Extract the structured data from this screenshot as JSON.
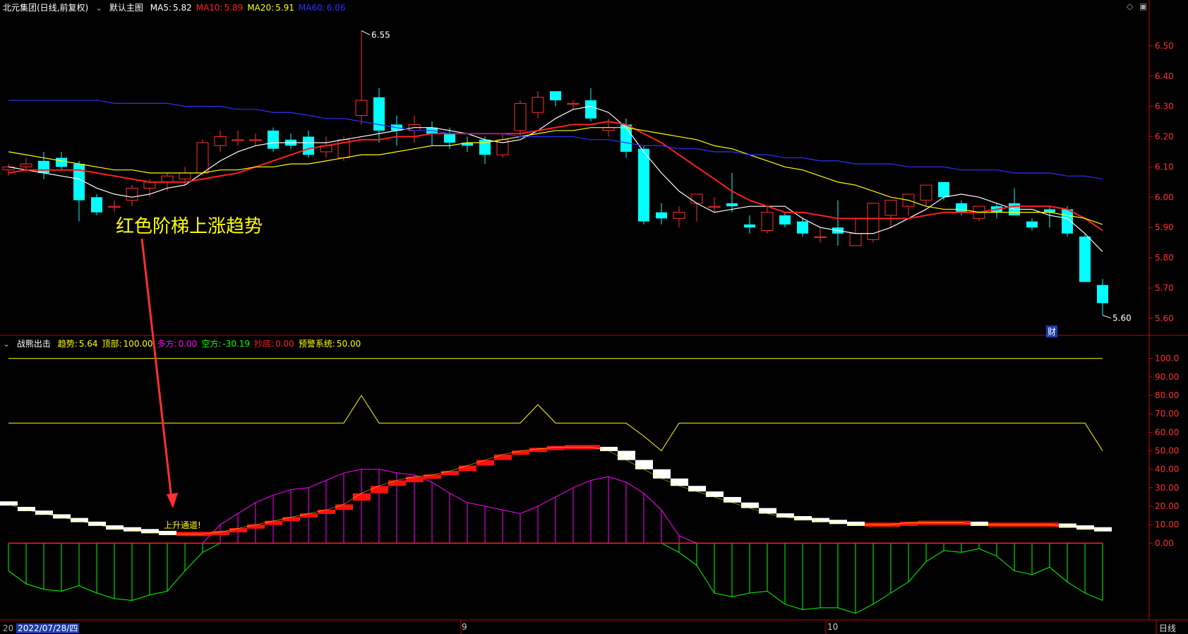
{
  "main_panel": {
    "header": {
      "symbol": "北元集团(日线,前复权)",
      "template": "默认主图",
      "ma": [
        {
          "label": "MA5:",
          "value": "5.82",
          "color": "#ffffff"
        },
        {
          "label": "MA10:",
          "value": "5.89",
          "color": "#ff2020"
        },
        {
          "label": "MA20:",
          "value": "5.91",
          "color": "#ffff00"
        },
        {
          "label": "MA60:",
          "value": "6.06",
          "color": "#3030ff"
        }
      ]
    },
    "annotation": "红色阶梯上涨趋势",
    "high_marker": "6.55",
    "low_marker": "5.60",
    "fin_badge": "财"
  },
  "sub_panel": {
    "header": {
      "name": "战熊出击",
      "items": [
        {
          "label": "趋势:",
          "value": "5.64",
          "color": "#ffff00"
        },
        {
          "label": "顶部:",
          "value": "100.00",
          "color": "#ffff00"
        },
        {
          "label": "多方:",
          "value": "0.00",
          "color": "#ff00ff"
        },
        {
          "label": "空方:",
          "value": "-30.19",
          "color": "#00ff00"
        },
        {
          "label": "抄底:",
          "value": "0.00",
          "color": "#ff2020"
        },
        {
          "label": "预警系统:",
          "value": "50.00",
          "color": "#ffff00"
        }
      ]
    },
    "annotation": "上升通道!"
  },
  "date_axis": {
    "cursor_date": "2022/07/28/四",
    "left_stub": "20",
    "months": [
      "9",
      "10"
    ],
    "period": "日线"
  },
  "colors": {
    "up": "#ff3030",
    "down": "#00ffff",
    "grid_line": "#cc0000"
  },
  "chart_data": [
    {
      "type": "candlestick",
      "title": "北元集团(日线,前复权)",
      "ylim": [
        5.56,
        6.6
      ],
      "yticks": [
        "6.50",
        "6.40",
        "6.30",
        "6.20",
        "6.10",
        "6.00",
        "5.90",
        "5.80",
        "5.70",
        "5.60"
      ],
      "ohlc": [
        [
          6.09,
          6.11,
          6.07,
          6.1
        ],
        [
          6.1,
          6.13,
          6.08,
          6.11
        ],
        [
          6.12,
          6.15,
          6.06,
          6.08
        ],
        [
          6.13,
          6.15,
          6.09,
          6.1
        ],
        [
          6.11,
          6.12,
          5.92,
          5.99
        ],
        [
          6.0,
          6.01,
          5.94,
          5.95
        ],
        [
          5.97,
          5.99,
          5.95,
          5.97
        ],
        [
          5.99,
          6.04,
          5.97,
          6.03
        ],
        [
          6.03,
          6.06,
          6.0,
          6.05
        ],
        [
          6.05,
          6.08,
          6.02,
          6.07
        ],
        [
          6.06,
          6.1,
          6.04,
          6.08
        ],
        [
          6.08,
          6.19,
          6.07,
          6.18
        ],
        [
          6.17,
          6.22,
          6.15,
          6.2
        ],
        [
          6.19,
          6.22,
          6.17,
          6.19
        ],
        [
          6.19,
          6.21,
          6.17,
          6.19
        ],
        [
          6.22,
          6.23,
          6.15,
          6.16
        ],
        [
          6.19,
          6.21,
          6.16,
          6.17
        ],
        [
          6.2,
          6.22,
          6.13,
          6.14
        ],
        [
          6.15,
          6.2,
          6.13,
          6.17
        ],
        [
          6.13,
          6.2,
          6.12,
          6.19
        ],
        [
          6.27,
          6.55,
          6.24,
          6.32
        ],
        [
          6.33,
          6.36,
          6.18,
          6.22
        ],
        [
          6.24,
          6.27,
          6.17,
          6.22
        ],
        [
          6.22,
          6.27,
          6.18,
          6.24
        ],
        [
          6.23,
          6.25,
          6.17,
          6.21
        ],
        [
          6.21,
          6.23,
          6.16,
          6.18
        ],
        [
          6.18,
          6.2,
          6.15,
          6.17
        ],
        [
          6.19,
          6.2,
          6.11,
          6.14
        ],
        [
          6.14,
          6.21,
          6.13,
          6.19
        ],
        [
          6.22,
          6.32,
          6.2,
          6.31
        ],
        [
          6.28,
          6.35,
          6.26,
          6.33
        ],
        [
          6.35,
          6.35,
          6.3,
          6.32
        ],
        [
          6.31,
          6.32,
          6.29,
          6.31
        ],
        [
          6.32,
          6.36,
          6.25,
          6.26
        ],
        [
          6.22,
          6.26,
          6.2,
          6.23
        ],
        [
          6.24,
          6.26,
          6.13,
          6.15
        ],
        [
          6.16,
          6.17,
          5.91,
          5.92
        ],
        [
          5.95,
          5.98,
          5.91,
          5.93
        ],
        [
          5.93,
          5.97,
          5.9,
          5.95
        ],
        [
          5.98,
          6.01,
          5.92,
          6.01
        ],
        [
          5.97,
          6.0,
          5.95,
          5.97
        ],
        [
          5.98,
          6.08,
          5.95,
          5.97
        ],
        [
          5.91,
          5.94,
          5.88,
          5.9
        ],
        [
          5.89,
          5.97,
          5.88,
          5.95
        ],
        [
          5.94,
          5.95,
          5.9,
          5.91
        ],
        [
          5.92,
          5.93,
          5.87,
          5.88
        ],
        [
          5.87,
          5.9,
          5.85,
          5.87
        ],
        [
          5.9,
          5.99,
          5.84,
          5.88
        ],
        [
          5.84,
          5.93,
          5.84,
          5.88
        ],
        [
          5.86,
          5.98,
          5.85,
          5.98
        ],
        [
          5.94,
          5.98,
          5.9,
          5.99
        ],
        [
          5.97,
          6.0,
          5.94,
          6.01
        ],
        [
          5.99,
          6.04,
          5.97,
          6.04
        ],
        [
          6.05,
          6.05,
          5.99,
          6.0
        ],
        [
          5.98,
          5.99,
          5.94,
          5.95
        ],
        [
          5.93,
          5.97,
          5.92,
          5.97
        ],
        [
          5.97,
          5.98,
          5.93,
          5.95
        ],
        [
          5.98,
          6.03,
          5.94,
          5.94
        ],
        [
          5.92,
          5.93,
          5.89,
          5.9
        ],
        [
          5.96,
          5.97,
          5.9,
          5.95
        ],
        [
          5.96,
          5.97,
          5.87,
          5.88
        ],
        [
          5.87,
          5.88,
          5.72,
          5.72
        ],
        [
          5.71,
          5.73,
          5.61,
          5.65
        ]
      ],
      "series": [
        {
          "name": "MA5",
          "color": "#ffffff",
          "values": [
            6.1,
            6.09,
            6.08,
            6.07,
            6.06,
            6.03,
            6.01,
            6.0,
            6.01,
            6.03,
            6.04,
            6.08,
            6.12,
            6.15,
            6.17,
            6.18,
            6.18,
            6.18,
            6.18,
            6.19,
            6.2,
            6.21,
            6.22,
            6.23,
            6.23,
            6.22,
            6.21,
            6.19,
            6.18,
            6.19,
            6.22,
            6.26,
            6.29,
            6.3,
            6.28,
            6.23,
            6.15,
            6.08,
            6.02,
            5.98,
            5.95,
            5.96,
            5.97,
            5.97,
            5.97,
            5.93,
            5.9,
            5.89,
            5.88,
            5.88,
            5.9,
            5.93,
            5.96,
            6.0,
            6.01,
            6.0,
            5.98,
            5.96,
            5.96,
            5.94,
            5.93,
            5.88,
            5.82
          ]
        },
        {
          "name": "MA10",
          "color": "#ff2020",
          "values": [
            6.08,
            6.09,
            6.09,
            6.09,
            6.09,
            6.08,
            6.07,
            6.06,
            6.05,
            6.05,
            6.05,
            6.06,
            6.07,
            6.08,
            6.1,
            6.12,
            6.14,
            6.16,
            6.17,
            6.18,
            6.19,
            6.19,
            6.2,
            6.2,
            6.21,
            6.21,
            6.21,
            6.21,
            6.21,
            6.21,
            6.22,
            6.23,
            6.24,
            6.24,
            6.25,
            6.24,
            6.21,
            6.18,
            6.14,
            6.1,
            6.06,
            6.02,
            5.99,
            5.97,
            5.95,
            5.95,
            5.94,
            5.93,
            5.93,
            5.93,
            5.93,
            5.93,
            5.94,
            5.95,
            5.95,
            5.95,
            5.96,
            5.97,
            5.97,
            5.97,
            5.96,
            5.93,
            5.89
          ]
        },
        {
          "name": "MA20",
          "color": "#ffff00",
          "values": [
            6.15,
            6.14,
            6.13,
            6.12,
            6.11,
            6.1,
            6.09,
            6.09,
            6.08,
            6.08,
            6.08,
            6.08,
            6.09,
            6.09,
            6.1,
            6.1,
            6.11,
            6.11,
            6.12,
            6.13,
            6.14,
            6.14,
            6.15,
            6.16,
            6.17,
            6.17,
            6.18,
            6.18,
            6.19,
            6.2,
            6.21,
            6.22,
            6.22,
            6.23,
            6.23,
            6.23,
            6.22,
            6.21,
            6.2,
            6.19,
            6.17,
            6.16,
            6.14,
            6.12,
            6.1,
            6.09,
            6.07,
            6.05,
            6.04,
            6.02,
            6.0,
            5.99,
            5.97,
            5.96,
            5.96,
            5.95,
            5.95,
            5.95,
            5.95,
            5.95,
            5.94,
            5.93,
            5.91
          ]
        },
        {
          "name": "MA60",
          "color": "#3030ff",
          "values": [
            6.32,
            6.32,
            6.32,
            6.32,
            6.32,
            6.32,
            6.31,
            6.31,
            6.31,
            6.31,
            6.3,
            6.3,
            6.3,
            6.29,
            6.29,
            6.28,
            6.28,
            6.27,
            6.26,
            6.26,
            6.25,
            6.24,
            6.23,
            6.22,
            6.22,
            6.21,
            6.21,
            6.21,
            6.21,
            6.2,
            6.2,
            6.2,
            6.2,
            6.19,
            6.19,
            6.18,
            6.17,
            6.17,
            6.16,
            6.16,
            6.15,
            6.15,
            6.14,
            6.14,
            6.13,
            6.13,
            6.12,
            6.12,
            6.11,
            6.11,
            6.11,
            6.1,
            6.1,
            6.1,
            6.09,
            6.09,
            6.09,
            6.08,
            6.08,
            6.08,
            6.07,
            6.07,
            6.06
          ]
        }
      ]
    },
    {
      "type": "indicator",
      "title": "战熊出击",
      "ylim": [
        -40,
        106
      ],
      "yticks": [
        "100.0",
        "90.00",
        "80.00",
        "70.00",
        "60.00",
        "50.00",
        "40.00",
        "30.00",
        "20.00",
        "10.00",
        "0.00"
      ],
      "top_line": 100,
      "warning": [
        65,
        65,
        65,
        65,
        65,
        65,
        65,
        65,
        65,
        65,
        65,
        65,
        65,
        65,
        65,
        65,
        65,
        65,
        65,
        65,
        80,
        65,
        65,
        65,
        65,
        65,
        65,
        65,
        65,
        65,
        75,
        65,
        65,
        65,
        65,
        65,
        58,
        50,
        65,
        65,
        65,
        65,
        65,
        65,
        65,
        65,
        65,
        65,
        65,
        65,
        65,
        65,
        65,
        65,
        65,
        65,
        65,
        65,
        65,
        65,
        65,
        65,
        50
      ],
      "bull": [
        0,
        0,
        0,
        0,
        0,
        0,
        0,
        0,
        0,
        0,
        0,
        0,
        10,
        16,
        22,
        26,
        29,
        30,
        34,
        38,
        40,
        40,
        38,
        37,
        33,
        27,
        22,
        20,
        18,
        16,
        20,
        25,
        30,
        34,
        36,
        33,
        27,
        18,
        4,
        0,
        0,
        0,
        0,
        0,
        0,
        0,
        0,
        0,
        0,
        0,
        0,
        0,
        0,
        0,
        0,
        0,
        0,
        0,
        0,
        0,
        0,
        0,
        0
      ],
      "bear": [
        -15,
        -22,
        -25,
        -26,
        -23,
        -27,
        -30,
        -31,
        -28,
        -26,
        -15,
        -5,
        0,
        0,
        0,
        0,
        0,
        0,
        0,
        0,
        0,
        0,
        0,
        0,
        0,
        0,
        0,
        0,
        0,
        0,
        0,
        0,
        0,
        0,
        0,
        0,
        0,
        0,
        -5,
        -12,
        -27,
        -29,
        -27,
        -26,
        -33,
        -36,
        -35,
        -35,
        -38,
        -33,
        -27,
        -21,
        -10,
        -4,
        -5,
        -3,
        -7,
        -15,
        -17,
        -13,
        -21,
        -27,
        -31
      ],
      "trend": [
        21,
        18,
        16,
        14,
        12,
        10,
        8,
        7,
        6,
        5,
        5,
        5,
        6,
        8,
        10,
        12,
        14,
        16,
        18,
        21,
        27,
        31,
        34,
        36,
        37,
        39,
        42,
        45,
        48,
        50,
        51,
        52,
        52,
        52,
        50,
        45,
        40,
        35,
        31,
        28,
        25,
        22,
        19,
        16,
        14,
        13,
        12,
        11,
        10,
        10,
        10,
        11,
        11,
        11,
        11,
        10,
        10,
        10,
        10,
        10,
        9,
        8,
        7
      ],
      "trend_open": [
        22,
        19,
        17,
        15,
        13,
        11,
        9,
        8,
        7,
        6,
        5,
        5,
        5,
        6,
        8,
        10,
        12,
        14,
        16,
        18,
        23,
        27,
        31,
        33,
        35,
        37,
        39,
        42,
        45,
        48,
        50,
        51,
        52,
        52,
        52,
        50,
        45,
        40,
        35,
        31,
        28,
        25,
        22,
        19,
        16,
        14,
        13,
        12,
        11,
        10,
        10,
        10,
        11,
        11,
        11,
        11,
        10,
        10,
        10,
        10,
        10,
        9,
        8
      ]
    }
  ]
}
